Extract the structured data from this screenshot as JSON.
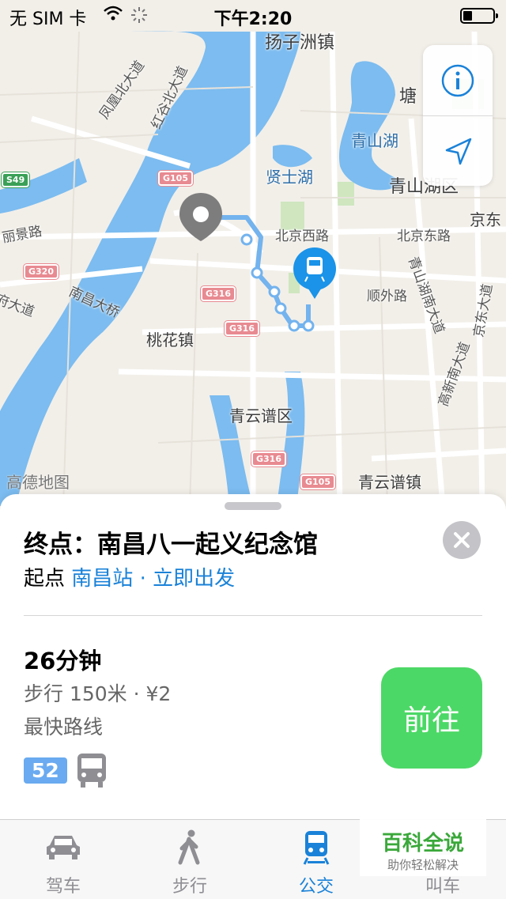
{
  "status_bar": {
    "carrier": "无 SIM 卡",
    "time": "下午2:20",
    "battery_level": 0.3
  },
  "map": {
    "labels": {
      "yangzizhou": "扬子洲镇",
      "tang": "塘",
      "qingshan_lake": "青山湖",
      "qingshan_hu": "青山湖区",
      "xianshi_lake": "贤士湖",
      "beijing_west": "北京西路",
      "beijing_east": "北京东路",
      "jing": "京东",
      "lijing": "丽景路",
      "shunwai": "顺外路",
      "nanchang_bridge": "南昌大桥",
      "taohua": "桃花镇",
      "qingyunpu_district": "青云谱区",
      "qingyunpu_town": "青云谱镇",
      "fengguang": "凤凰北大道",
      "honggu": "红谷北大道",
      "qingshan_south": "青山湖南大道",
      "gaoxin_south": "高新南大道",
      "jingdong": "京东大道",
      "fuda": "府大道"
    },
    "shields": {
      "s49": "S49",
      "g105a": "G105",
      "g320": "G320",
      "g316a": "G316",
      "g316b": "G316",
      "g316c": "G316",
      "g105b": "G105"
    },
    "provider": "高德地图"
  },
  "controls": {
    "info_icon": "info-icon",
    "locate_icon": "location-arrow-icon"
  },
  "route": {
    "destination": "终点：南昌八一起义纪念馆",
    "origin_label": "起点",
    "origin_station": "南昌站",
    "separator": "·",
    "depart": "立即出发",
    "duration": "26分钟",
    "walk_info": "步行 150米 · ¥2",
    "tag": "最快路线",
    "bus_number": "52",
    "go_button": "前往"
  },
  "tabs": [
    {
      "label": "驾车",
      "icon": "car-icon"
    },
    {
      "label": "步行",
      "icon": "walk-icon"
    },
    {
      "label": "公交",
      "icon": "train-icon"
    },
    {
      "label": "叫车",
      "icon": "taxi-icon"
    }
  ],
  "watermark": {
    "title": "百科全说",
    "subtitle": "助你轻松解决"
  }
}
